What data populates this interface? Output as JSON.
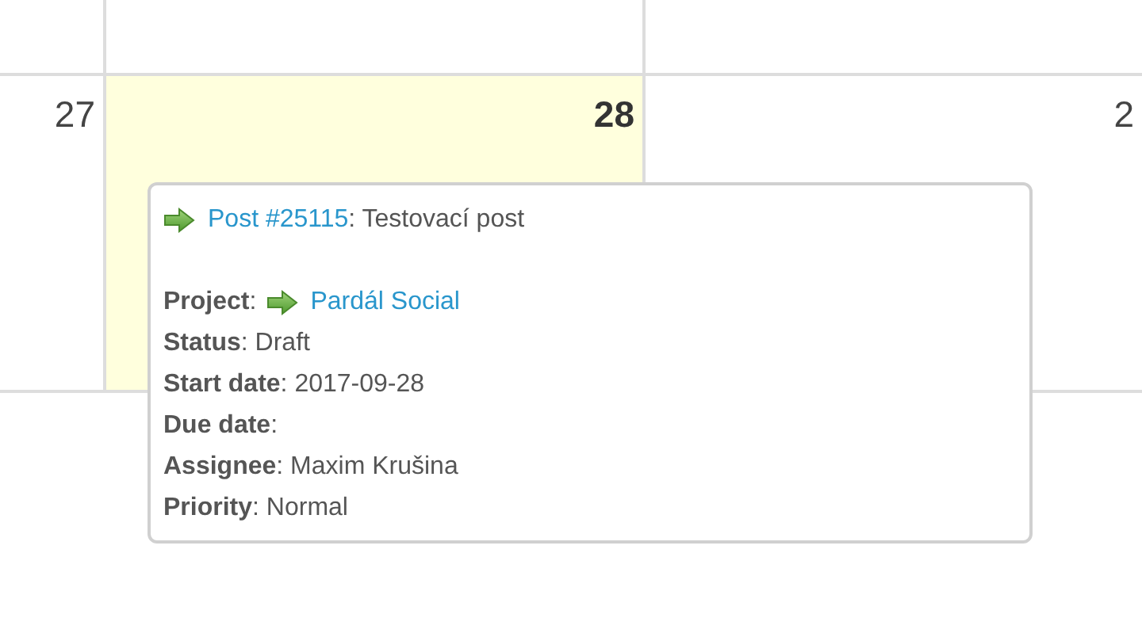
{
  "calendar": {
    "days": [
      {
        "number": "27",
        "today": false
      },
      {
        "number": "28",
        "today": true
      },
      {
        "number": "2",
        "today": false
      }
    ]
  },
  "tooltip": {
    "title": {
      "link": "Post #25115",
      "text": ": Testovací post"
    },
    "fields": [
      {
        "kind": "link",
        "text": "**Project**:",
        "link": "Pardál Social"
      },
      {
        "kind": "text",
        "text": "**Status**: Draft"
      },
      {
        "kind": "text",
        "text": "**Start date**: 2017-09-28"
      },
      {
        "kind": "text",
        "text": "**Due date**:"
      },
      {
        "kind": "text",
        "text": "**Assignee**: Maxim Krušina"
      },
      {
        "kind": "text",
        "text": "**Priority**: Normal"
      }
    ]
  }
}
